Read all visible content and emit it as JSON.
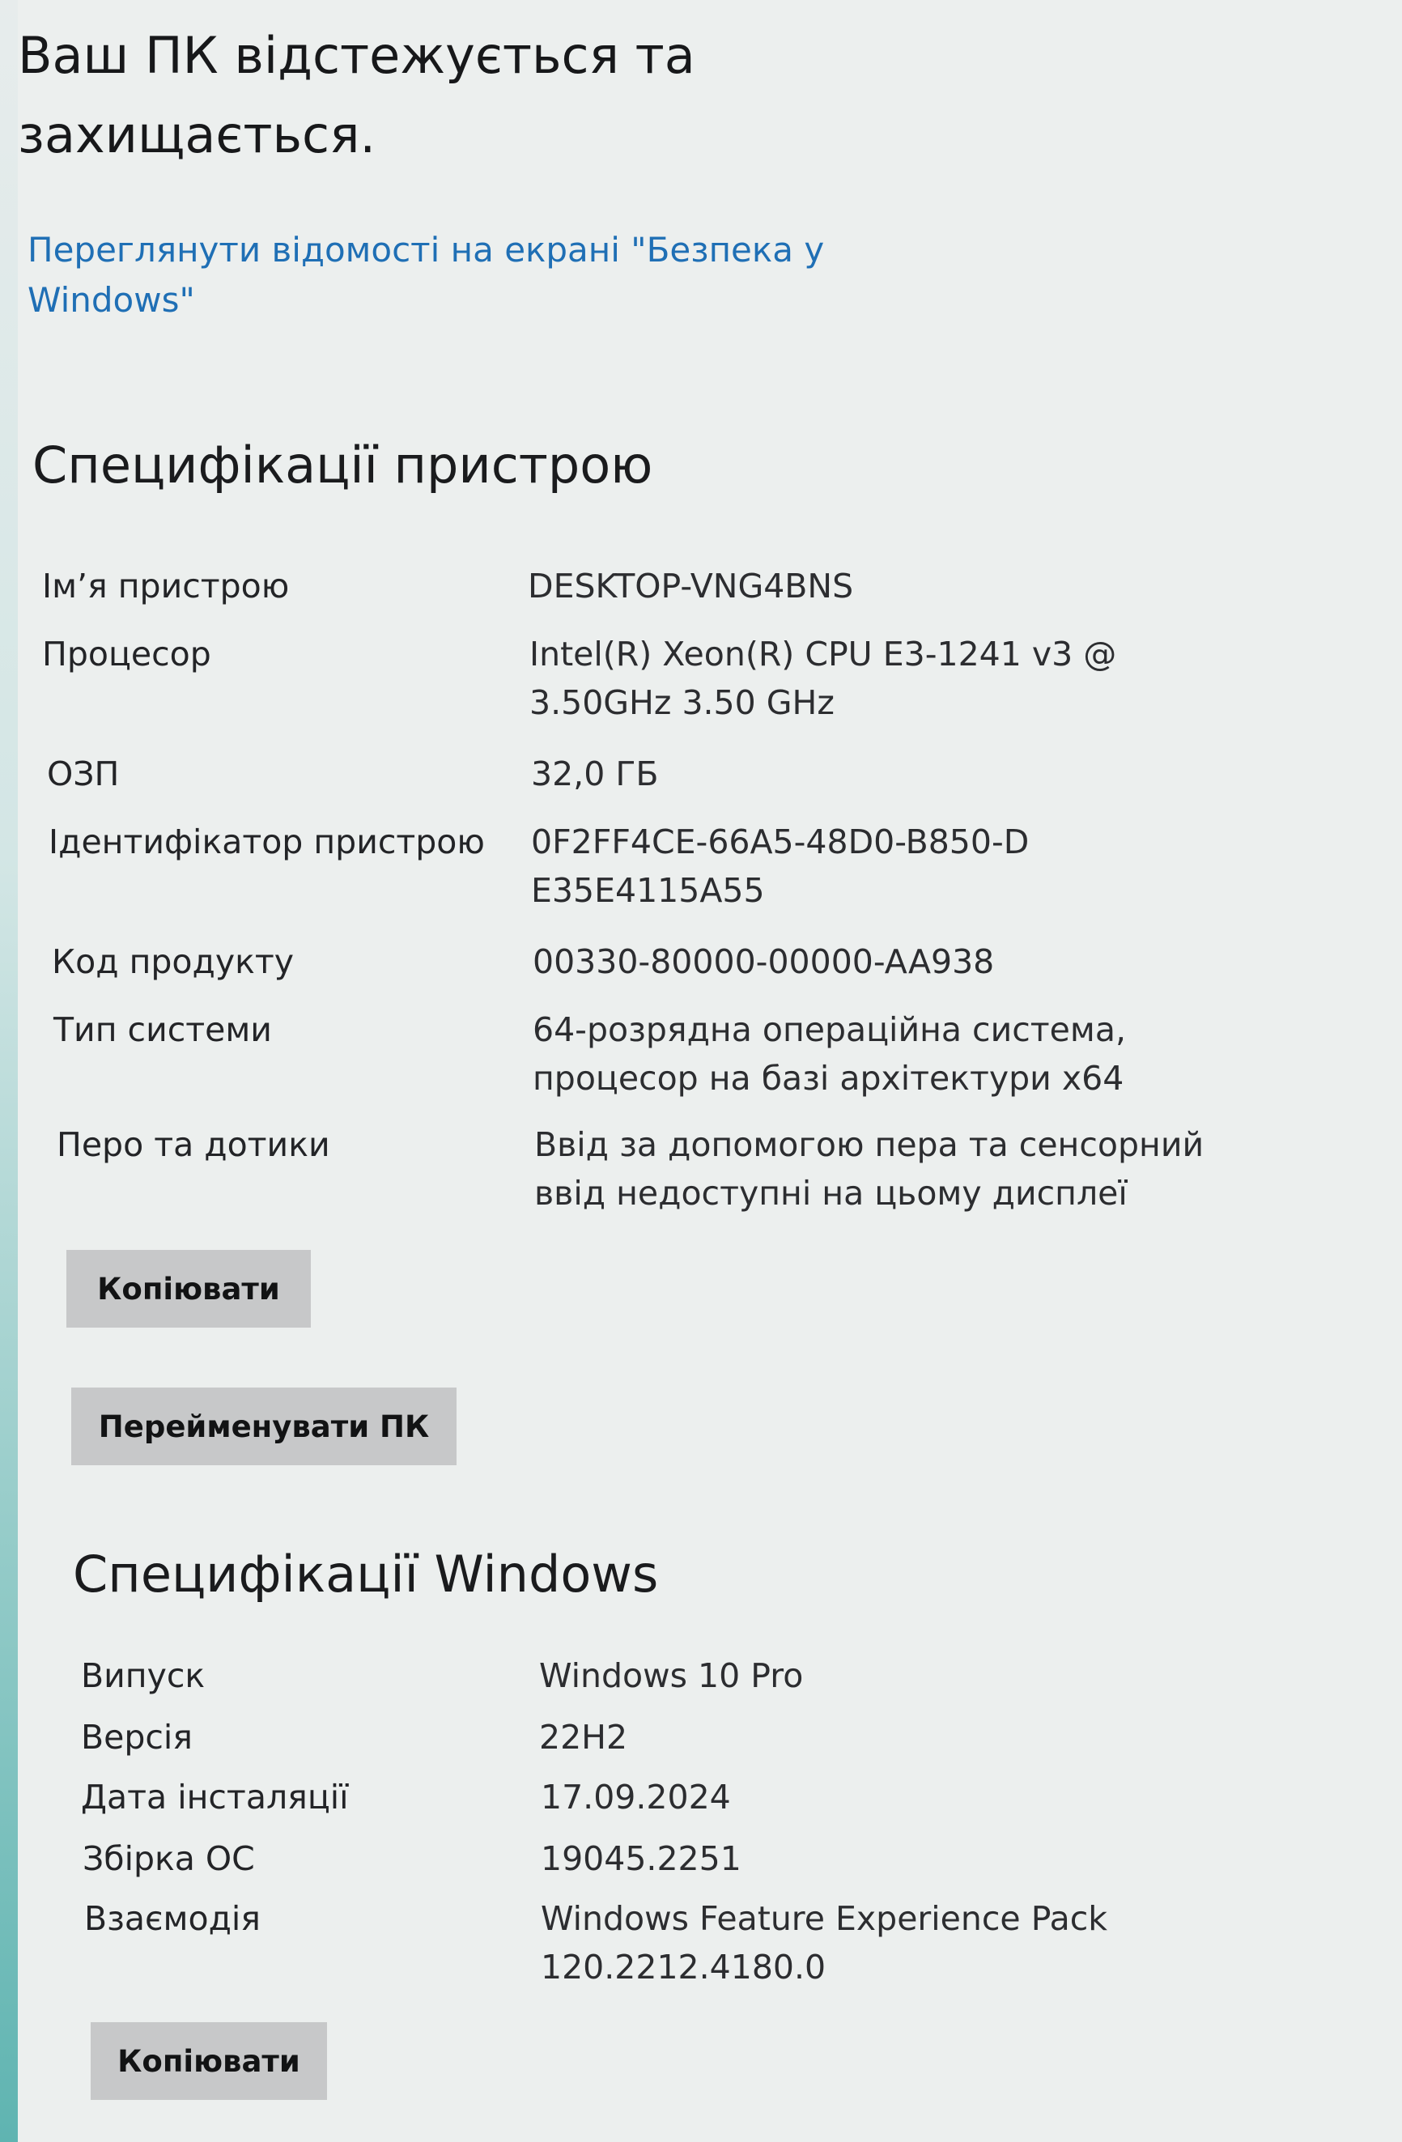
{
  "security": {
    "status_text": "Ваш ПК відстежується та захищається.",
    "link_text": "Переглянути відомості на екрані \"Безпека у Windows\""
  },
  "device_specs": {
    "title": "Специфікації пристрою",
    "rows": [
      {
        "label": "Ім’я пристрою",
        "value": "DESKTOP-VNG4BNS"
      },
      {
        "label": "Процесор",
        "value": "Intel(R) Xeon(R) CPU E3-1241 v3 @ 3.50GHz   3.50 GHz"
      },
      {
        "label": "ОЗП",
        "value": "32,0 ГБ"
      },
      {
        "label": "Ідентифікатор пристрою",
        "value": "0F2FF4CE-66A5-48D0-B850-DE35E4115A55"
      },
      {
        "label": "Код продукту",
        "value": "00330-80000-00000-AA938"
      },
      {
        "label": "Тип системи",
        "value": "64-розрядна операційна система, процесор на базі архітектури x64"
      },
      {
        "label": "Перо та дотики",
        "value": "Ввід за допомогою пера та сенсорний ввід недоступні на цьому дисплеї"
      }
    ],
    "copy_button": "Копіювати",
    "rename_button": "Перейменувати ПК"
  },
  "windows_specs": {
    "title": "Специфікації Windows",
    "rows": [
      {
        "label": "Випуск",
        "value": "Windows 10 Pro"
      },
      {
        "label": "Версія",
        "value": "22H2"
      },
      {
        "label": "Дата інсталяції",
        "value": "17.09.2024"
      },
      {
        "label": "Збірка ОС",
        "value": "19045.2251"
      },
      {
        "label": "Взаємодія",
        "value": "Windows Feature Experience Pack 120.2212.4180.0"
      }
    ],
    "copy_button": "Копіювати"
  }
}
